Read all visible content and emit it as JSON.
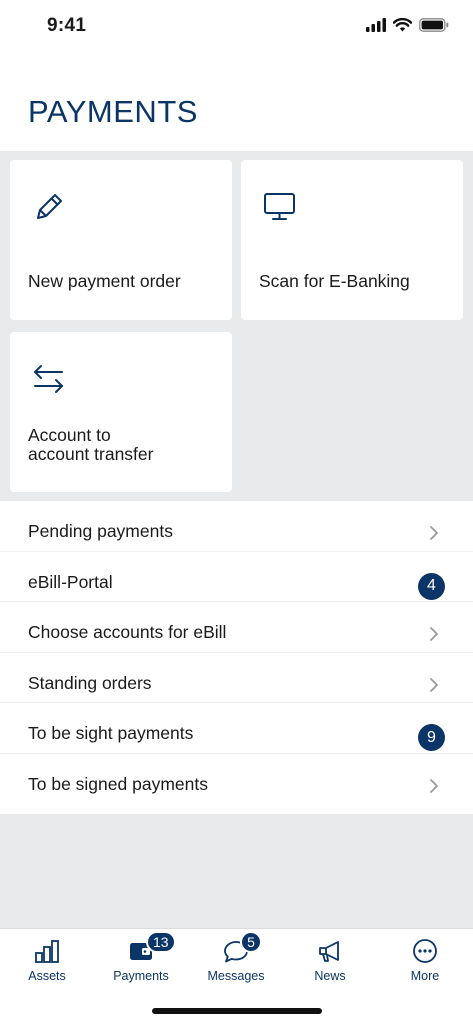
{
  "status_bar": {
    "time": "9:41"
  },
  "page": {
    "title": "PAYMENTS"
  },
  "tiles": [
    {
      "label": "New payment order",
      "icon": "pencil-icon"
    },
    {
      "label": "Scan for E-Banking",
      "icon": "monitor-icon"
    },
    {
      "label_line1": "Account to",
      "label_line2": "account transfer",
      "icon": "transfer-arrows-icon"
    }
  ],
  "list": [
    {
      "label": "Pending payments"
    },
    {
      "label": "eBill-Portal",
      "badge": "4"
    },
    {
      "label": "Choose accounts for eBill"
    },
    {
      "label": "Standing orders"
    },
    {
      "label": "To be sight payments",
      "badge": "9"
    },
    {
      "label": "To be signed payments"
    }
  ],
  "tabbar": {
    "items": [
      {
        "label": "Assets",
        "icon": "bar-chart-icon"
      },
      {
        "label": "Payments",
        "icon": "wallet-icon",
        "badge": "13"
      },
      {
        "label": "Messages",
        "icon": "chat-bubble-icon",
        "badge": "5"
      },
      {
        "label": "News",
        "icon": "megaphone-icon"
      },
      {
        "label": "More",
        "icon": "more-dots-icon"
      }
    ]
  },
  "colors": {
    "accent": "#0b3566",
    "background_grey": "#e9eaec"
  }
}
